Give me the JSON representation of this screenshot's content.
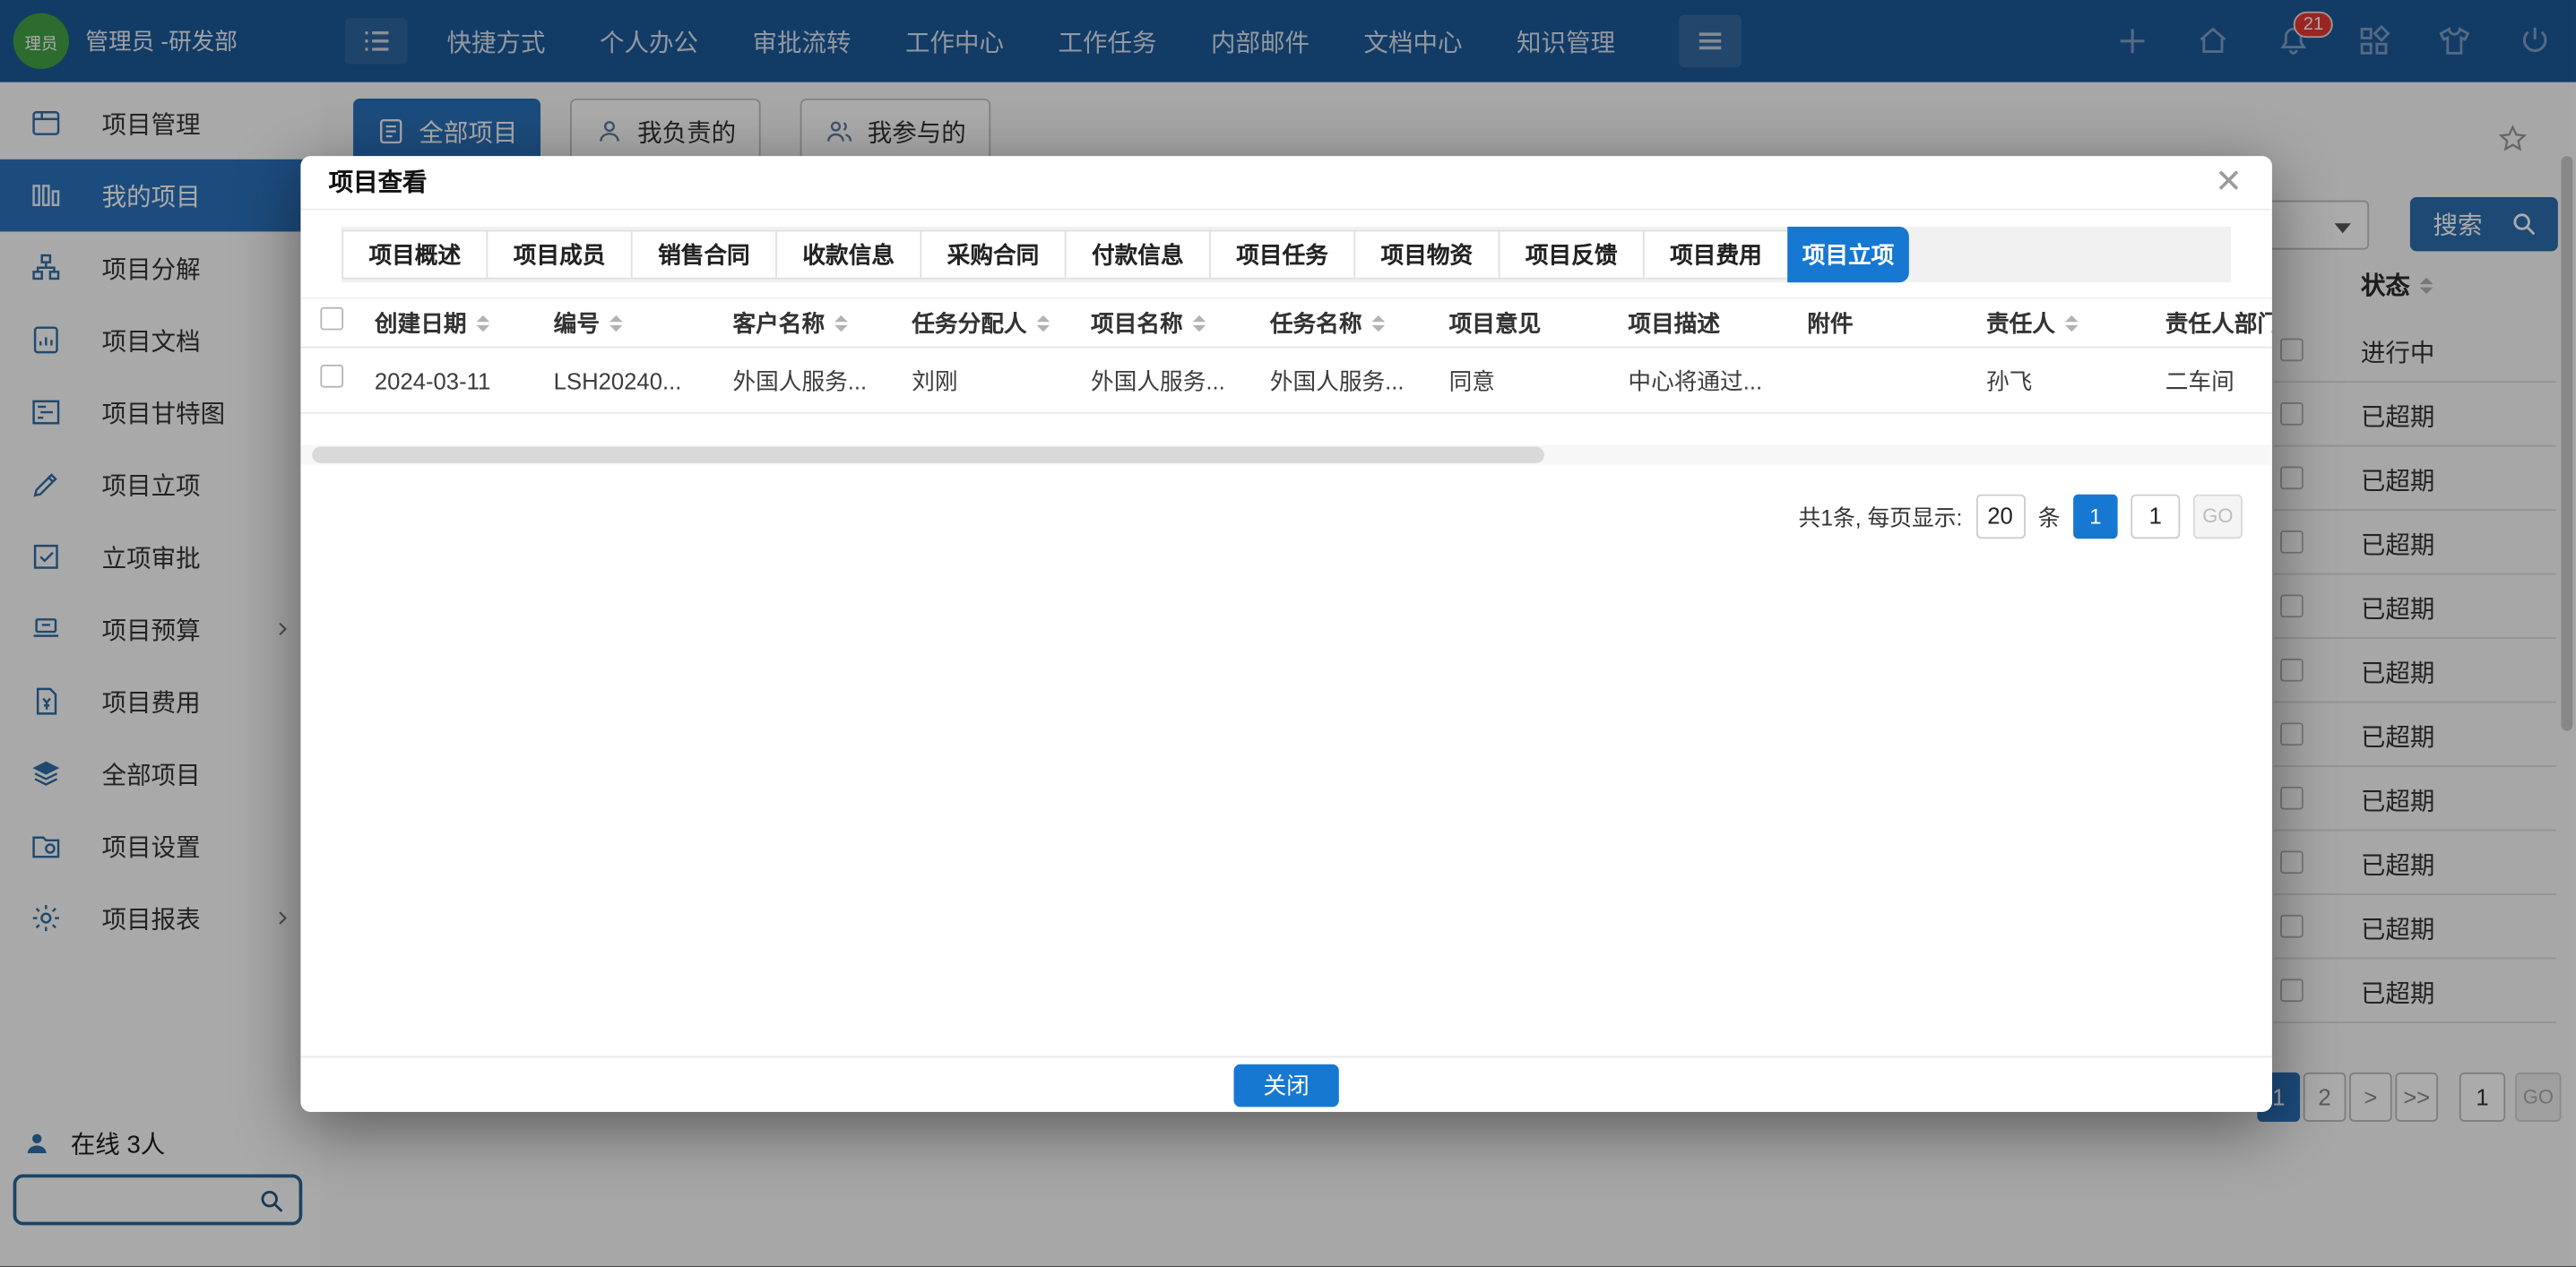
{
  "topbar": {
    "avatar_text": "理员",
    "user": "管理员 -研发部",
    "menu": [
      "快捷方式",
      "个人办公",
      "审批流转",
      "工作中心",
      "工作任务",
      "内部邮件",
      "文档中心",
      "知识管理"
    ],
    "notification_count": "21",
    "icons": [
      "list-menu-icon",
      "hamburger-icon",
      "plus-icon",
      "home-icon",
      "bell-icon",
      "apps-icon",
      "theme-icon",
      "power-icon"
    ]
  },
  "sidebar": {
    "items": [
      {
        "label": "项目管理",
        "icon": "app-window-icon"
      },
      {
        "label": "我的项目",
        "icon": "columns-icon",
        "active": true
      },
      {
        "label": "项目分解",
        "icon": "org-chart-icon"
      },
      {
        "label": "项目文档",
        "icon": "document-chart-icon"
      },
      {
        "label": "项目甘特图",
        "icon": "gantt-icon"
      },
      {
        "label": "项目立项",
        "icon": "pencil-icon"
      },
      {
        "label": "立项审批",
        "icon": "check-square-icon"
      },
      {
        "label": "项目预算",
        "icon": "laptop-icon",
        "has_submenu": true
      },
      {
        "label": "项目费用",
        "icon": "money-document-icon"
      },
      {
        "label": "全部项目",
        "icon": "layers-icon"
      },
      {
        "label": "项目设置",
        "icon": "folder-gear-icon"
      },
      {
        "label": "项目报表",
        "icon": "gear-icon",
        "has_submenu": true
      }
    ],
    "online_label": "在线 3人"
  },
  "content": {
    "filters": [
      {
        "label": "全部项目",
        "active": true
      },
      {
        "label": "我负责的"
      },
      {
        "label": "我参与的"
      }
    ],
    "search_button": "搜索",
    "status_header": "状态",
    "status_rows": [
      "进行中",
      "已超期",
      "已超期",
      "已超期",
      "已超期",
      "已超期",
      "已超期",
      "已超期",
      "已超期",
      "已超期",
      "已超期"
    ],
    "pagination": {
      "page_1": "1",
      "page_2": "2",
      "next": ">",
      "last": ">>",
      "goto_value": "1",
      "go_label": "GO"
    }
  },
  "modal": {
    "title": "项目查看",
    "tabs": [
      {
        "label": "项目概述"
      },
      {
        "label": "项目成员"
      },
      {
        "label": "销售合同"
      },
      {
        "label": "收款信息"
      },
      {
        "label": "采购合同"
      },
      {
        "label": "付款信息"
      },
      {
        "label": "项目任务"
      },
      {
        "label": "项目物资"
      },
      {
        "label": "项目反馈"
      },
      {
        "label": "项目费用"
      },
      {
        "label": "项目立项",
        "active": true
      }
    ],
    "table": {
      "headers": [
        {
          "label": "创建日期",
          "sortable": true
        },
        {
          "label": "编号",
          "sortable": true
        },
        {
          "label": "客户名称",
          "sortable": true
        },
        {
          "label": "任务分配人",
          "sortable": true
        },
        {
          "label": "项目名称",
          "sortable": true
        },
        {
          "label": "任务名称",
          "sortable": true
        },
        {
          "label": "项目意见",
          "sortable": false
        },
        {
          "label": "项目描述",
          "sortable": false
        },
        {
          "label": "附件",
          "sortable": false
        },
        {
          "label": "责任人",
          "sortable": true
        },
        {
          "label": "责任人部门",
          "sortable": true
        }
      ],
      "row": [
        "2024-03-11",
        "LSH20240...",
        "外国人服务...",
        "刘刚",
        "外国人服务...",
        "外国人服务...",
        "同意",
        "中心将通过...",
        "",
        "孙飞",
        "二车间"
      ]
    },
    "pagination": {
      "summary": "共1条, 每页显示:",
      "page_size": "20",
      "unit": "条",
      "current_page": "1",
      "goto_value": "1",
      "go_label": "GO"
    },
    "close_button": "关闭"
  },
  "colors": {
    "navbar": "#1c5998",
    "accent_blue": "#1778d1",
    "sidebar_active": "#2a72bd",
    "badge_red": "#e53935",
    "overlay": "rgba(0,0,0,0.33)"
  }
}
